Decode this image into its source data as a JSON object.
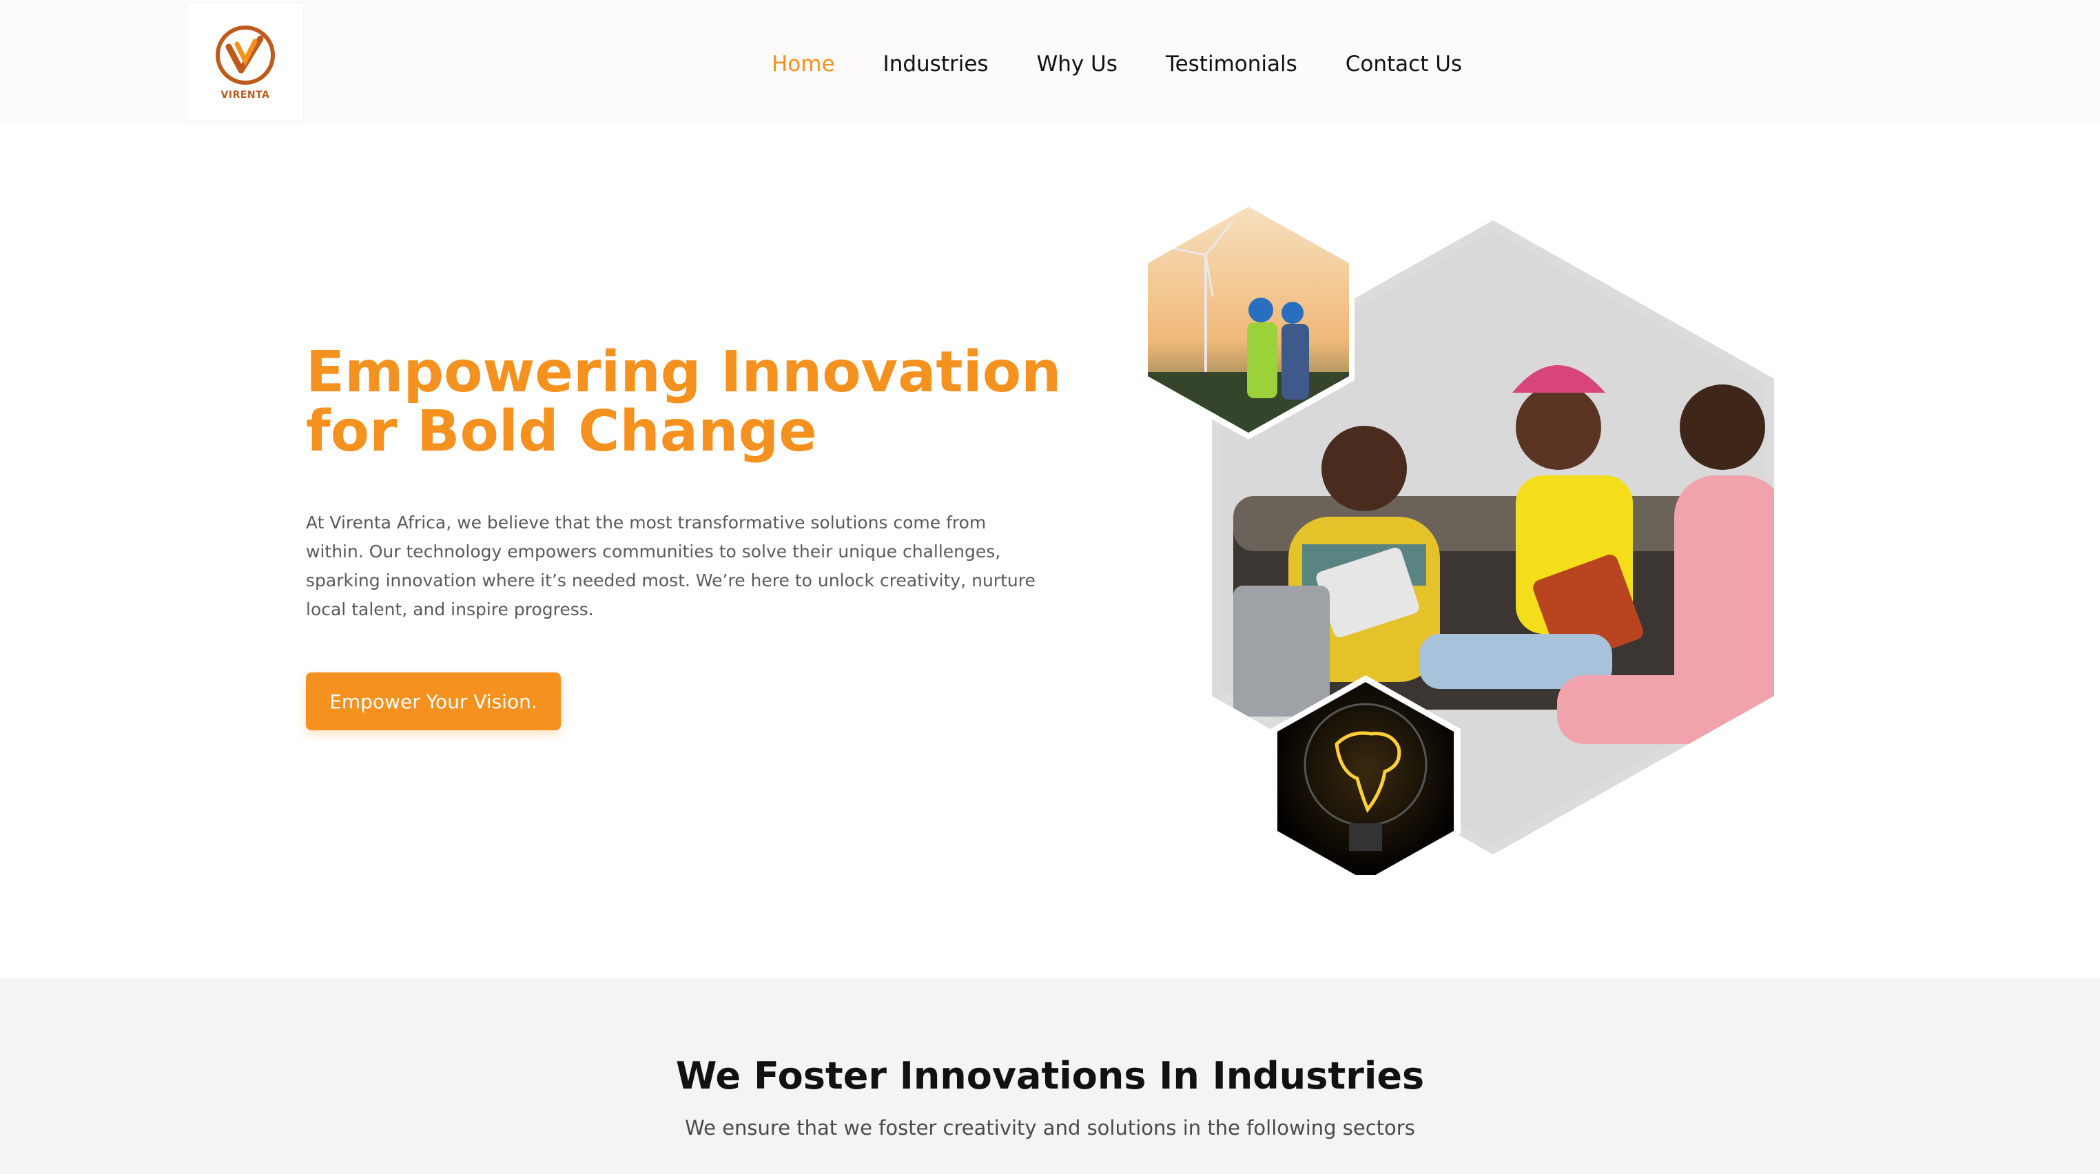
{
  "brand": {
    "logo_text": "VIRENTA",
    "logo_icon": "v-checkmark-logo",
    "primary_color": "#f5911e",
    "logo_color": "#c05a1c"
  },
  "nav": {
    "items": [
      {
        "label": "Home",
        "active": true
      },
      {
        "label": "Industries",
        "active": false
      },
      {
        "label": "Why Us",
        "active": false
      },
      {
        "label": "Testimonials",
        "active": false
      },
      {
        "label": "Contact Us",
        "active": false
      }
    ]
  },
  "hero": {
    "title_line1": "Empowering Innovation",
    "title_line2": "for Bold Change",
    "paragraph": "At Virenta Africa, we believe that the most transformative solutions come from within. Our technology empowers communities to solve their unique challenges, sparking innovation where it’s needed most. We’re here to unlock creativity, nurture local talent, and inspire progress.",
    "cta_label": "Empower Your Vision.",
    "images": {
      "main": "women-collaborating-photo",
      "top": "wind-turbine-engineers-photo",
      "bottom": "africa-lightbulb-photo"
    }
  },
  "industries": {
    "title": "We Foster Innovations In Industries",
    "subtitle": "We ensure that we foster creativity and solutions in the following sectors"
  }
}
